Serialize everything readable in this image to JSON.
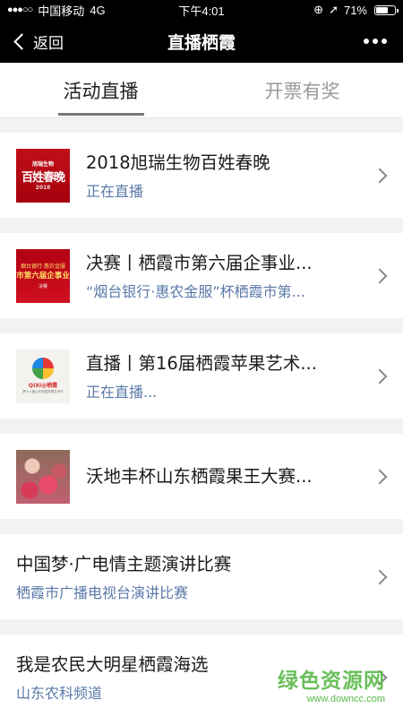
{
  "status_bar": {
    "signal": "●●●○○",
    "carrier": "中国移动",
    "network": "4G",
    "time": "下午4:01",
    "lock_icon": "rotation-lock-icon",
    "location_icon": "location-arrow-icon",
    "battery": "71%",
    "battery_level": 0.71
  },
  "nav": {
    "back_label": "返回",
    "title": "直播栖霞",
    "more_icon": "more-dots-icon"
  },
  "tabs": [
    {
      "label": "活动直播",
      "active": true
    },
    {
      "label": "开票有奖",
      "active": false
    }
  ],
  "items": [
    {
      "title": "2018旭瑞生物百姓春晚",
      "subtitle": "正在直播",
      "thumb_type": "red",
      "thumb_text": [
        "旭瑞生物",
        "百姓春晚",
        "2018"
      ]
    },
    {
      "title": "决赛丨栖霞市第六届企事业...",
      "subtitle": "“烟台银行·惠农金服”杯栖霞市第...",
      "thumb_type": "red2",
      "thumb_text": [
        "烟台银行·惠农金服",
        "市第六届企事业",
        "决赛"
      ]
    },
    {
      "title": "直播丨第16届栖霞苹果艺术...",
      "subtitle": "正在直播...",
      "thumb_type": "logo",
      "thumb_text": [
        "QIXI@栖霞",
        "第十六届山东栖霞苹果艺术节"
      ]
    },
    {
      "title": "沃地丰杯山东栖霞果王大赛...",
      "subtitle": "",
      "thumb_type": "photo",
      "thumb_text": []
    },
    {
      "title": "中国梦·广电情主题演讲比赛",
      "subtitle": "栖霞市广播电视台演讲比赛",
      "thumb_type": "none",
      "thumb_text": []
    },
    {
      "title": "我是农民大明星栖霞海选",
      "subtitle": "山东农科频道",
      "thumb_type": "none",
      "thumb_text": []
    }
  ],
  "watermark": {
    "title": "绿色资源网",
    "url": "www.downcc.com"
  },
  "colors": {
    "bar_bg": "#000000",
    "subtitle": "#5a78a8",
    "watermark": "#5ab94a"
  }
}
